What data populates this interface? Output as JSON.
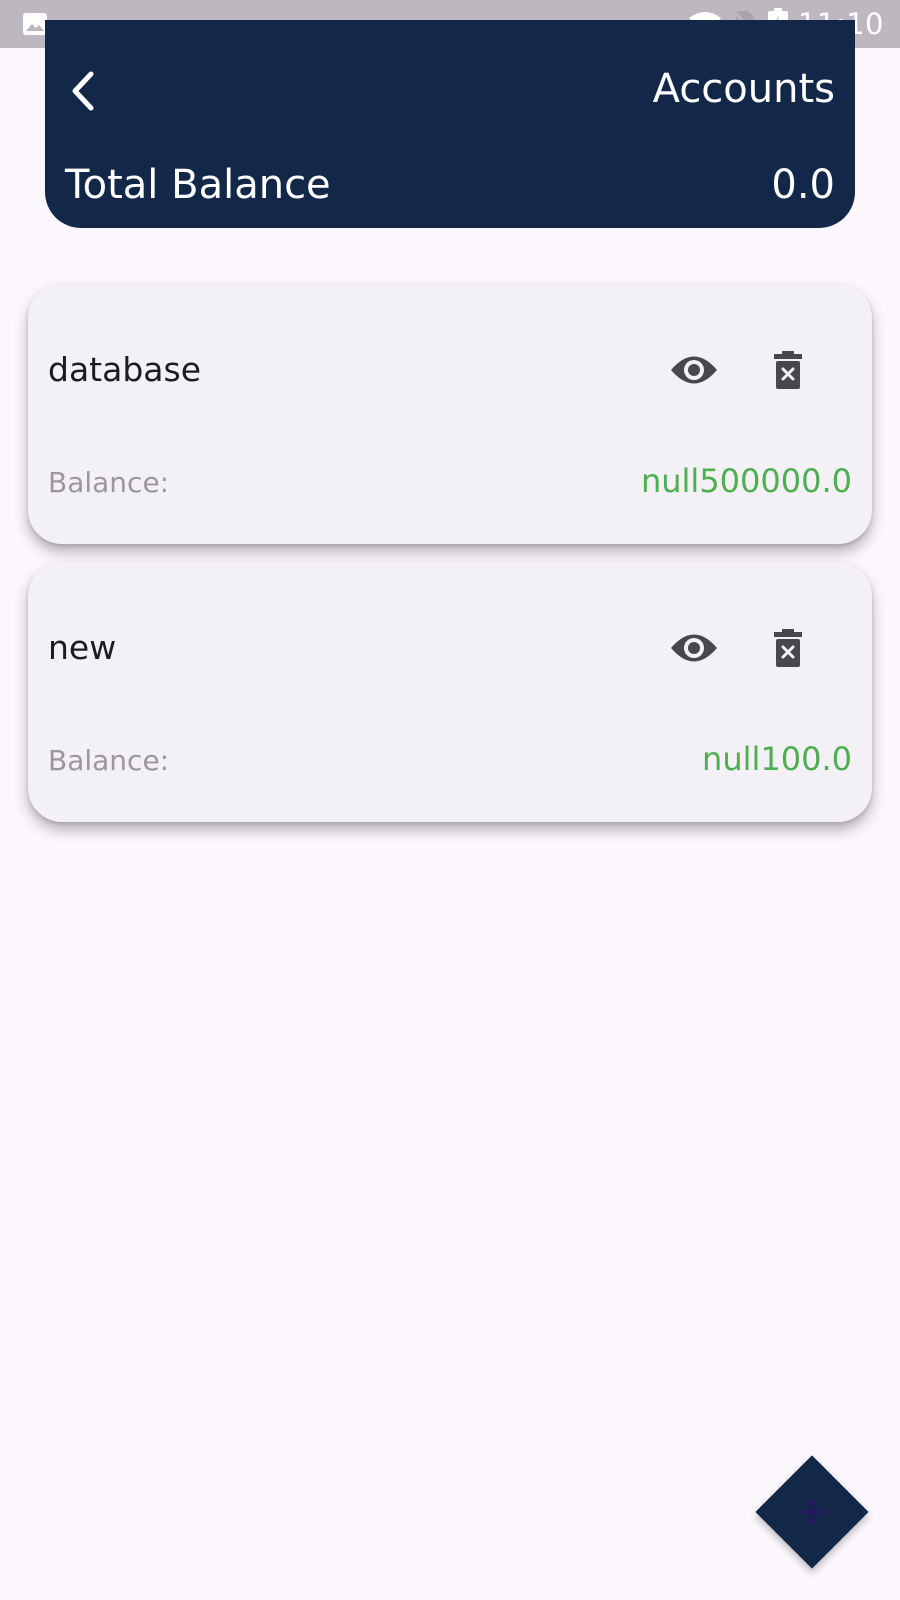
{
  "status_bar": {
    "time": "11:10",
    "icons": [
      "image-icon",
      "wifi-icon",
      "no-sim-icon",
      "battery-charging-icon"
    ]
  },
  "header": {
    "title": "Accounts",
    "back_icon": "chevron-left-icon",
    "total_label": "Total Balance",
    "total_value": "0.0"
  },
  "accounts": [
    {
      "name": "database",
      "balance_label": "Balance:",
      "balance_value": "null500000.0",
      "actions": [
        "eye-icon",
        "delete-icon"
      ]
    },
    {
      "name": "new",
      "balance_label": "Balance:",
      "balance_value": "null100.0",
      "actions": [
        "eye-icon",
        "delete-icon"
      ]
    }
  ],
  "fab": {
    "icon": "plus-icon"
  },
  "colors": {
    "header_bg": "#132848",
    "background": "#fcf6fd",
    "card_bg": "#f4f1f6",
    "balance_value": "#4caf50",
    "balance_label": "#9b979d",
    "fab_plus": "#2a1466"
  }
}
